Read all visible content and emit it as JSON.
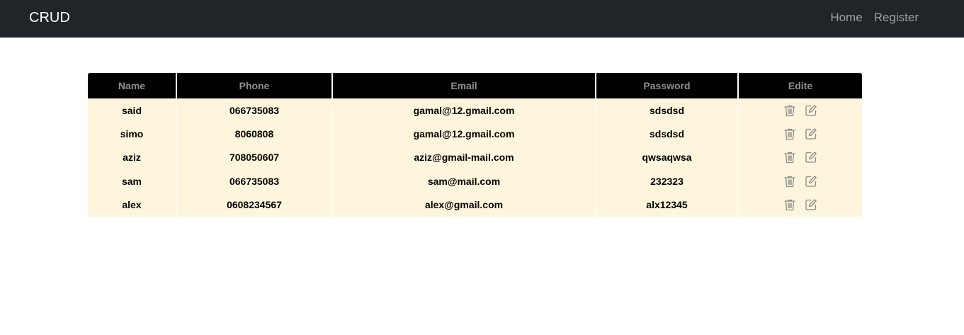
{
  "navbar": {
    "brand": "CRUD",
    "links": [
      {
        "label": "Home"
      },
      {
        "label": "Register"
      }
    ]
  },
  "table": {
    "headers": {
      "name": "Name",
      "phone": "Phone",
      "email": "Email",
      "password": "Password",
      "edit": "Edite"
    },
    "rows": [
      {
        "name": "said",
        "phone": "066735083",
        "email": "gamal@12.gmail.com",
        "password": "sdsdsd"
      },
      {
        "name": "simo",
        "phone": "8060808",
        "email": "gamal@12.gmail.com",
        "password": "sdsdsd"
      },
      {
        "name": "aziz",
        "phone": "708050607",
        "email": "aziz@gmail-mail.com",
        "password": "qwsaqwsa"
      },
      {
        "name": "sam",
        "phone": "066735083",
        "email": "sam@mail.com",
        "password": "232323"
      },
      {
        "name": "alex",
        "phone": "0608234567",
        "email": "alex@gmail.com",
        "password": "alx12345"
      }
    ],
    "row_actions": [
      {
        "icon": "trash-icon"
      },
      {
        "icon": "edit-icon"
      }
    ]
  },
  "colors": {
    "navbar_bg": "#212428",
    "header_bg": "#000000",
    "row_bg": "#fdf6dc",
    "icon_color": "#8a8a8a"
  }
}
